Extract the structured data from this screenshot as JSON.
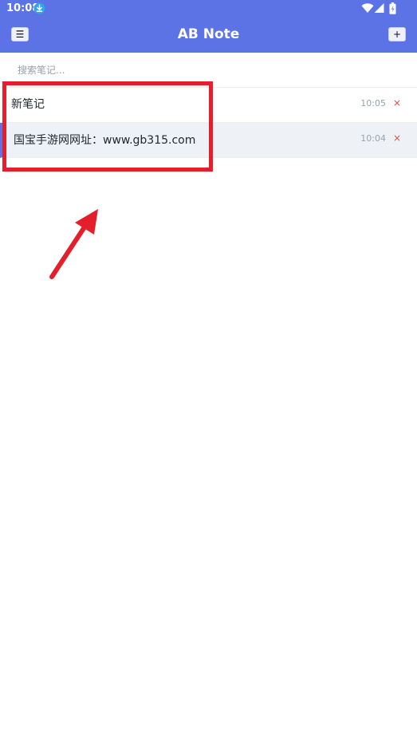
{
  "status_bar": {
    "time": "10:08",
    "icons": [
      "download-icon",
      "wifi-icon",
      "signal-icon",
      "battery-icon"
    ]
  },
  "app_bar": {
    "title": "AB Note",
    "menu_label": "☰",
    "add_label": "+"
  },
  "search": {
    "placeholder": "搜索笔记...",
    "value": ""
  },
  "notes": [
    {
      "title": "新笔记",
      "time": "10:05",
      "delete_label": "×",
      "selected": false
    },
    {
      "title": "国宝手游网网址：www.gb315.com",
      "time": "10:04",
      "delete_label": "×",
      "selected": true
    }
  ],
  "colors": {
    "primary": "#5b73e4",
    "selected_row": "#eef2f6",
    "delete": "#e24a4a",
    "annotation": "#e41e2b"
  }
}
